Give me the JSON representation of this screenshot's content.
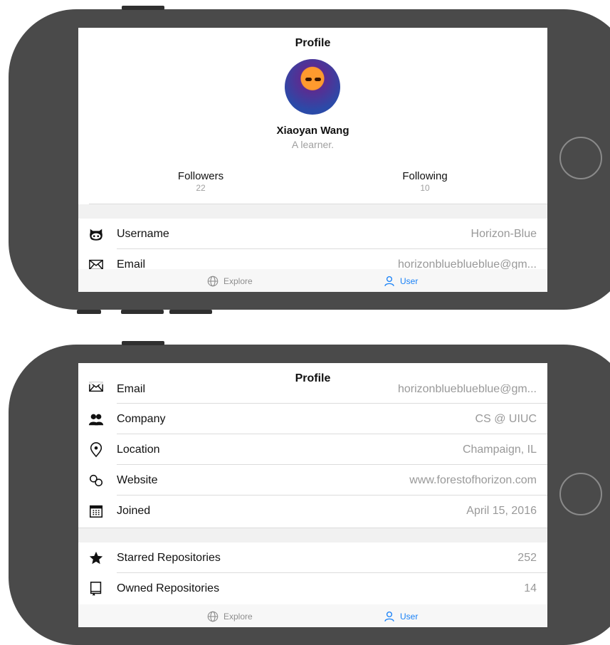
{
  "nav": {
    "title": "Profile"
  },
  "profile": {
    "name": "Xiaoyan Wang",
    "bio": "A learner."
  },
  "stats": [
    {
      "label": "Followers",
      "value": "22"
    },
    {
      "label": "Following",
      "value": "10"
    }
  ],
  "info_rows": [
    {
      "icon": "github-octocat-icon",
      "label": "Username",
      "value": "Horizon-Blue"
    },
    {
      "icon": "envelope-icon",
      "label": "Email",
      "value": "horizonblueblueblue@gm..."
    },
    {
      "icon": "people-icon",
      "label": "Company",
      "value": "CS @ UIUC"
    },
    {
      "icon": "location-pin-icon",
      "label": "Location",
      "value": "Champaign, IL"
    },
    {
      "icon": "link-icon",
      "label": "Website",
      "value": "www.forestofhorizon.com"
    },
    {
      "icon": "calendar-icon",
      "label": "Joined",
      "value": "April 15, 2016"
    }
  ],
  "repo_rows": [
    {
      "icon": "star-icon",
      "label": "Starred Repositories",
      "value": "252"
    },
    {
      "icon": "book-icon",
      "label": "Owned Repositories",
      "value": "14"
    }
  ],
  "tabbar": {
    "explore_label": "Explore",
    "user_label": "User"
  },
  "colors": {
    "accent": "#1a82f7",
    "inactive": "#8e8e8e",
    "bezel": "#4a4a4a"
  }
}
